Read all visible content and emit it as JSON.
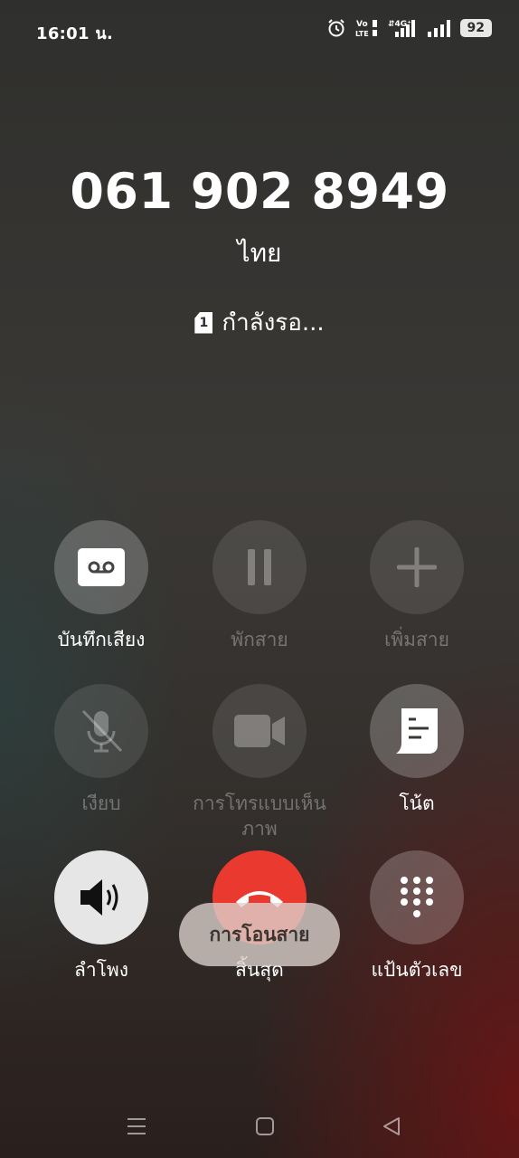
{
  "status_bar": {
    "time": "16:01 น.",
    "battery": "92",
    "icons": [
      "alarm-icon",
      "volte-icon",
      "4g-icon",
      "signal-icon-1",
      "signal-icon-2",
      "battery-icon"
    ]
  },
  "call": {
    "number": "061 902 8949",
    "location": "ไทย",
    "sim": "1",
    "status": "กำลังรอ..."
  },
  "controls": [
    {
      "label": "บันทึกเสียง",
      "icon": "record-icon",
      "enabled": true
    },
    {
      "label": "พักสาย",
      "icon": "pause-icon",
      "enabled": false
    },
    {
      "label": "เพิ่มสาย",
      "icon": "add-icon",
      "enabled": false
    },
    {
      "label": "เงียบ",
      "icon": "mic-off-icon",
      "enabled": false
    },
    {
      "label": "การโทรแบบเห็นภาพ",
      "icon": "video-icon",
      "enabled": false
    },
    {
      "label": "โน้ต",
      "icon": "note-icon",
      "enabled": true
    },
    {
      "label": "ลำโพง",
      "icon": "speaker-icon",
      "enabled": true
    },
    {
      "label": "สิ้นสุด",
      "icon": "end-call-icon",
      "enabled": true
    },
    {
      "label": "แป้นตัวเลข",
      "icon": "dialpad-icon",
      "enabled": true
    }
  ],
  "toast": {
    "text": "การโอนสาย"
  },
  "nav": [
    "menu-icon",
    "home-icon",
    "back-icon"
  ],
  "colors": {
    "end_call": "#ea3a30",
    "speaker_active": "#e6e6e6"
  }
}
